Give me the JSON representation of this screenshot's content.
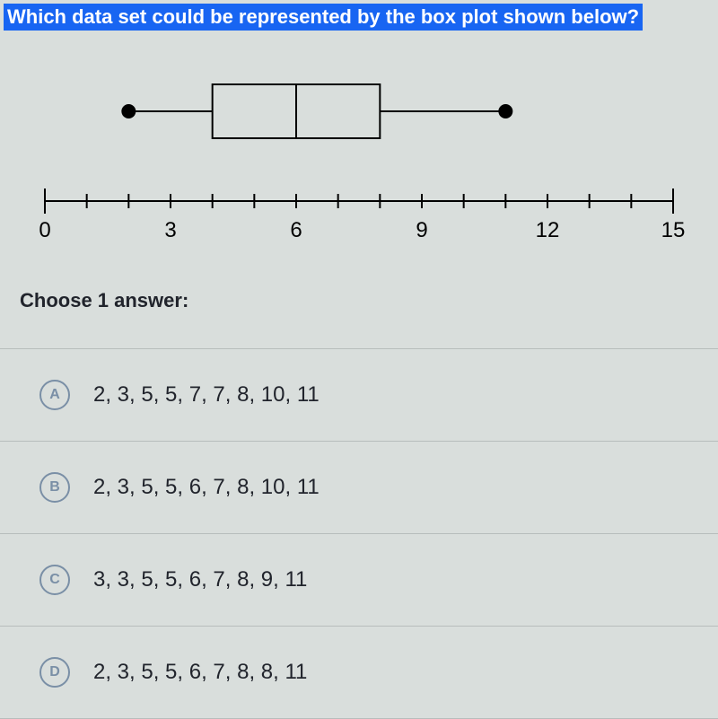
{
  "question": "Which data set could be represented by the box plot shown below?",
  "prompt": "Choose 1 answer:",
  "axis": {
    "min": 0,
    "max": 15,
    "ticks": [
      0,
      3,
      6,
      9,
      12,
      15
    ]
  },
  "boxplot": {
    "min": 2,
    "q1": 4,
    "median": 6,
    "q3": 8,
    "max": 11
  },
  "options": [
    {
      "letter": "A",
      "text": "2, 3, 5, 5, 7, 7, 8, 10, 11"
    },
    {
      "letter": "B",
      "text": "2, 3, 5, 5, 6, 7, 8, 10, 11"
    },
    {
      "letter": "C",
      "text": "3, 3, 5, 5, 6, 7, 8, 9, 11"
    },
    {
      "letter": "D",
      "text": "2, 3, 5, 5, 6, 7, 8, 8, 11"
    }
  ],
  "chart_data": {
    "type": "boxplot",
    "five_number_summary": {
      "min": 2,
      "q1": 4,
      "median": 6,
      "q3": 8,
      "max": 11
    },
    "xlim": [
      0,
      15
    ],
    "xticks": [
      0,
      3,
      6,
      9,
      12,
      15
    ],
    "title": "",
    "xlabel": "",
    "ylabel": ""
  }
}
